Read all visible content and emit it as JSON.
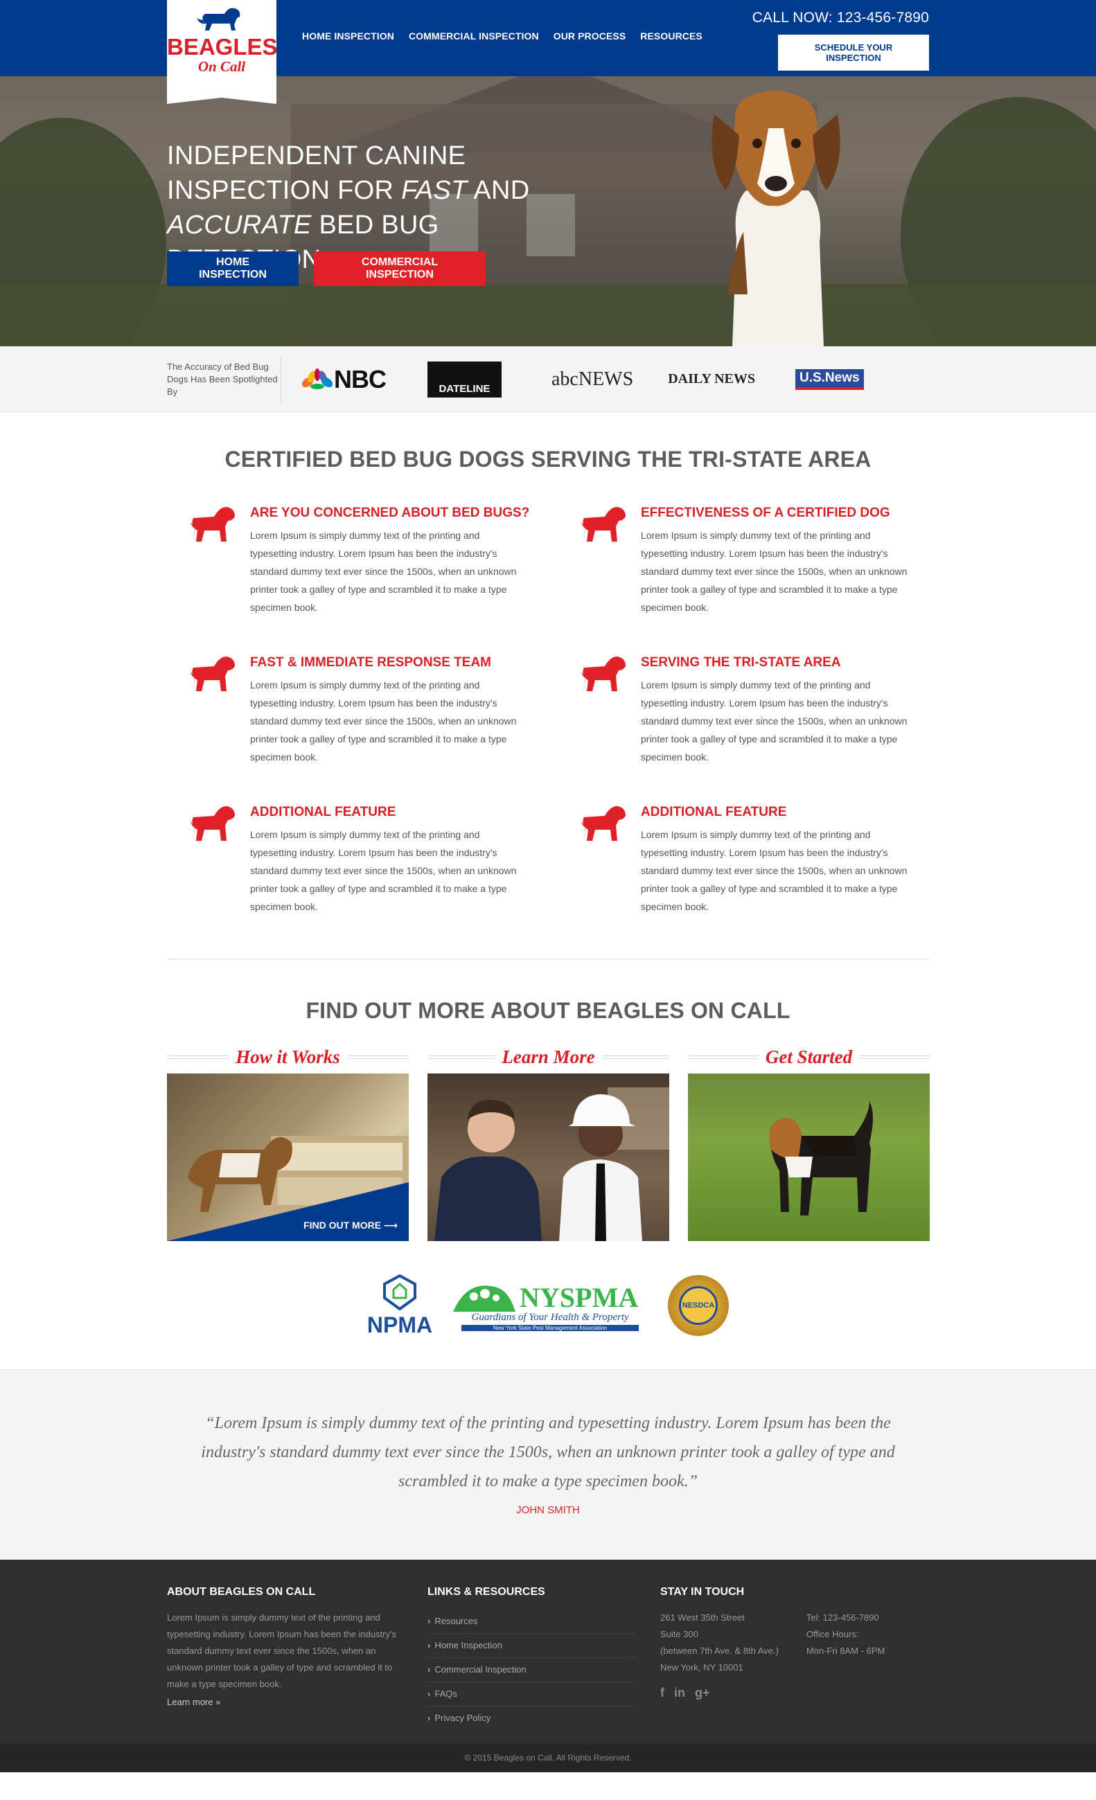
{
  "header": {
    "logo_line1": "BEAGLES",
    "logo_line2": "On Call",
    "nav": [
      "HOME INSPECTION",
      "COMMERCIAL INSPECTION",
      "OUR PROCESS",
      "RESOURCES"
    ],
    "call_now": "CALL NOW: 123-456-7890",
    "schedule_label": "SCHEDULE YOUR INSPECTION"
  },
  "hero": {
    "line1": "INDEPENDENT CANINE",
    "line2_prefix": "INSPECTION FOR ",
    "line2_em": "FAST",
    "line2_suffix": " AND",
    "line3_em": "ACCURATE",
    "line3_suffix": " BED BUG DETECTION",
    "btn_home": "HOME INSPECTION",
    "btn_commercial": "COMMERCIAL INSPECTION"
  },
  "press": {
    "caption": "The Accuracy of Bed Bug Dogs Has Been Spotlighted By",
    "logos": [
      "NBC",
      "DATELINE",
      "abcNEWS",
      "DAILY NEWS",
      "U.S.News"
    ]
  },
  "features": {
    "title": "CERTIFIED BED BUG DOGS SERVING THE TRI-STATE AREA",
    "items": [
      {
        "title": "ARE YOU CONCERNED ABOUT BED BUGS?",
        "text": "Lorem Ipsum is simply dummy text of the printing and typesetting industry. Lorem Ipsum has been the industry's standard dummy text ever since the 1500s, when an unknown printer took a galley of type and scrambled it to make a type specimen book."
      },
      {
        "title": "EFFECTIVENESS OF A CERTIFIED DOG",
        "text": "Lorem Ipsum is simply dummy text of the printing and typesetting industry. Lorem Ipsum has been the industry's standard dummy text ever since the 1500s, when an unknown printer took a galley of type and scrambled it to make a type specimen book."
      },
      {
        "title": "FAST & IMMEDIATE RESPONSE TEAM",
        "text": "Lorem Ipsum is simply dummy text of the printing and typesetting industry. Lorem Ipsum has been the industry's standard dummy text ever since the 1500s, when an unknown printer took a galley of type and scrambled it to make a type specimen book."
      },
      {
        "title": "SERVING THE TRI-STATE AREA",
        "text": "Lorem Ipsum is simply dummy text of the printing and typesetting industry. Lorem Ipsum has been the industry's standard dummy text ever since the 1500s, when an unknown printer took a galley of type and scrambled it to make a type specimen book."
      },
      {
        "title": "ADDITIONAL FEATURE",
        "text": "Lorem Ipsum is simply dummy text of the printing and typesetting industry. Lorem Ipsum has been the industry's standard dummy text ever since the 1500s, when an unknown printer took a galley of type and scrambled it to make a type specimen book."
      },
      {
        "title": "ADDITIONAL FEATURE",
        "text": "Lorem Ipsum is simply dummy text of the printing and typesetting industry. Lorem Ipsum has been the industry's standard dummy text ever since the 1500s, when an unknown printer took a galley of type and scrambled it to make a type specimen book."
      }
    ]
  },
  "findmore": {
    "title": "FIND OUT MORE ABOUT BEAGLES ON CALL",
    "cards": [
      {
        "title": "How it Works",
        "cta": "FIND OUT MORE ⟶"
      },
      {
        "title": "Learn More"
      },
      {
        "title": "Get Started"
      }
    ],
    "assoc": {
      "npma": "NPMA",
      "nyspma": "NYSPMA",
      "nyspma_tag": "Guardians of Your Health & Property",
      "nyspma_sub": "New York State Pest Management Association",
      "nesdca": "NESDCA"
    }
  },
  "testimonial": {
    "quote": "“Lorem Ipsum is simply dummy text of the printing and typesetting industry. Lorem Ipsum has been the industry's standard dummy text ever since the 1500s, when an unknown printer took a galley of type and scrambled it to make a type specimen book.”",
    "author": "JOHN SMITH"
  },
  "footer": {
    "about_title": "ABOUT BEAGLES ON CALL",
    "about_text": "Lorem Ipsum is simply dummy text of the printing and typesetting industry. Lorem Ipsum has been the industry's standard dummy text ever since the 1500s, when an unknown printer took a galley of type and scrambled it to make a type specimen book.",
    "learn_more": "Learn more »",
    "links_title": "LINKS & RESOURCES",
    "links": [
      "Resources",
      "Home Inspection",
      "Commercial Inspection",
      "FAQs",
      "Privacy Policy"
    ],
    "touch_title": "STAY IN TOUCH",
    "address": [
      "261 West 35th Street",
      "Suite 300",
      "(between 7th Ave. & 8th Ave.)",
      "New York, NY 10001"
    ],
    "phone": "Tel: 123-456-7890",
    "hours_label": "Office Hours:",
    "hours": "Mon-Fri 8AM - 6PM",
    "social": [
      "f",
      "in",
      "g+"
    ],
    "copyright": "© 2015 Beagles on Call. All Rights Reserved."
  },
  "colors": {
    "brand_blue": "#023a8e",
    "brand_red": "#d92027",
    "button_red": "#e02128",
    "footer_bg": "#2f2f2f"
  }
}
